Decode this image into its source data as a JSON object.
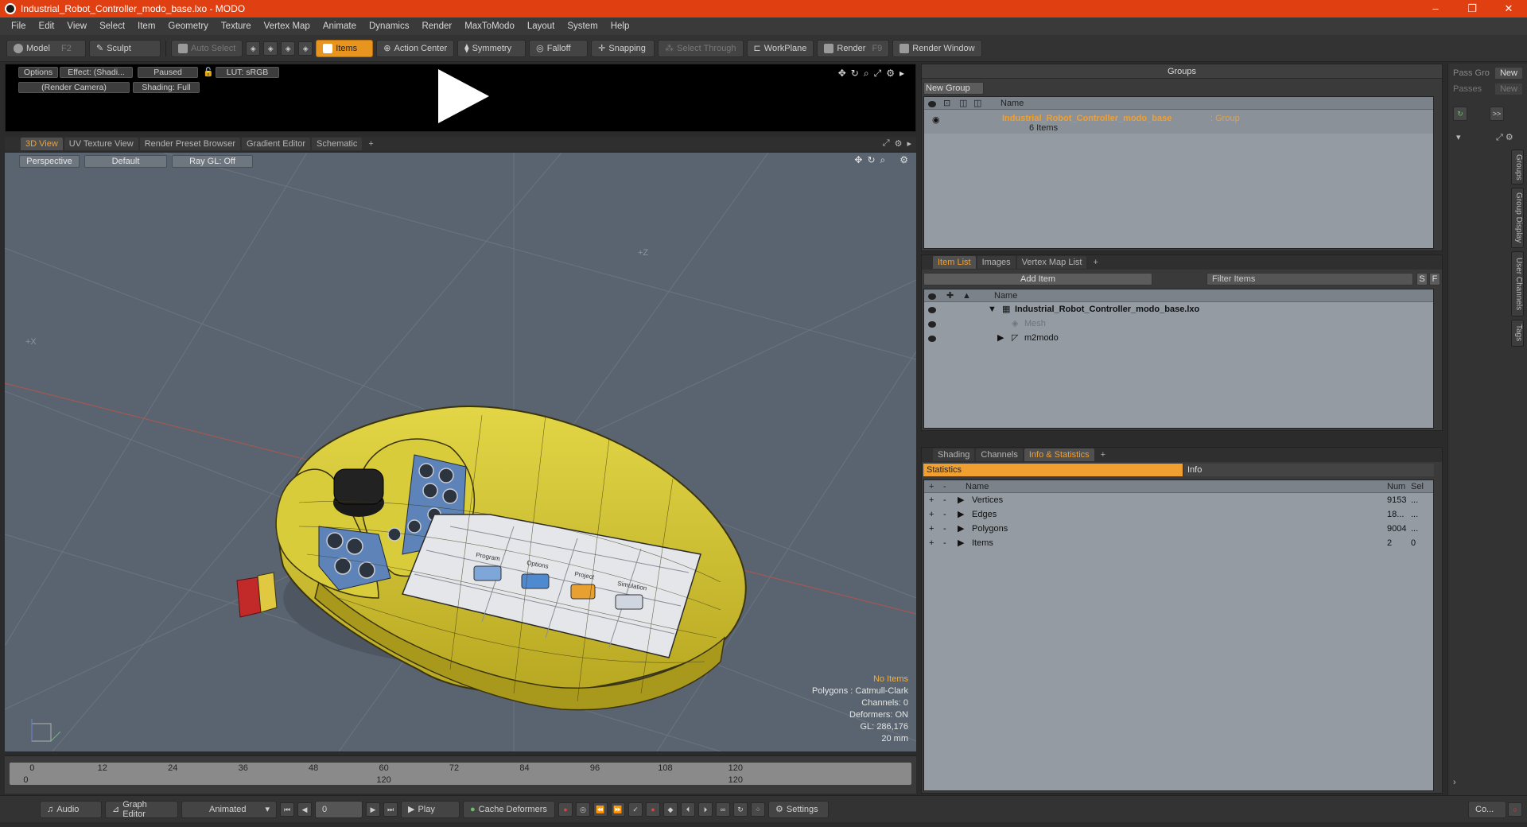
{
  "window": {
    "title": "Industrial_Robot_Controller_modo_base.lxo - MODO",
    "minimize": "–",
    "maximize": "❐",
    "close": "✕"
  },
  "menu": [
    "File",
    "Edit",
    "View",
    "Select",
    "Item",
    "Geometry",
    "Texture",
    "Vertex Map",
    "Animate",
    "Dynamics",
    "Render",
    "MaxToModo",
    "Layout",
    "System",
    "Help"
  ],
  "toolbar": {
    "model": "Model",
    "model_key": "F2",
    "sculpt": "Sculpt",
    "auto_select": "Auto Select",
    "items": "Items",
    "action_center": "Action Center",
    "symmetry": "Symmetry",
    "falloff": "Falloff",
    "snapping": "Snapping",
    "select_through": "Select Through",
    "workplane": "WorkPlane",
    "render": "Render",
    "render_key": "F9",
    "render_window": "Render Window"
  },
  "preview": {
    "options": "Options",
    "effect": "Effect: (Shadi...",
    "paused": "Paused",
    "lut": "LUT: sRGB",
    "camera": "(Render Camera)",
    "shading": "Shading: Full"
  },
  "viewport_tabs": [
    "3D View",
    "UV Texture View",
    "Render Preset Browser",
    "Gradient Editor",
    "Schematic",
    "+"
  ],
  "viewport": {
    "perspective": "Perspective",
    "default": "Default",
    "raygl": "Ray GL: Off",
    "axis_z": "+Z",
    "axis_x": "+X",
    "info": {
      "no_items": "No Items",
      "polygons": "Polygons : Catmull-Clark",
      "channels": "Channels: 0",
      "deformers": "Deformers: ON",
      "gl": "GL: 286,176",
      "scale": "20 mm"
    },
    "screen_labels": [
      "Program",
      "Options",
      "Project",
      "Simulation"
    ]
  },
  "timeline": {
    "ticks": [
      "0",
      "12",
      "24",
      "36",
      "48",
      "60",
      "72",
      "84",
      "96",
      "108",
      "120"
    ],
    "lower": [
      "0",
      "120",
      "120"
    ]
  },
  "transport": {
    "audio": "Audio",
    "graph_editor": "Graph Editor",
    "animated": "Animated",
    "frame": "0",
    "play": "Play",
    "cache_deformers": "Cache Deformers",
    "settings": "Settings"
  },
  "groups": {
    "title": "Groups",
    "new_group": "New Group",
    "col_name": "Name",
    "item_name": "Industrial_Robot_Controller_modo_base",
    "item_type": ": Group",
    "item_count": "6 Items"
  },
  "passes": {
    "pass_group": "Pass Gro",
    "passes": "Passes",
    "new1": "New",
    "new2": "New",
    "more": ">>"
  },
  "item_list": {
    "tabs": [
      "Item List",
      "Images",
      "Vertex Map List",
      "+"
    ],
    "add_item": "Add Item",
    "filter": "Filter Items",
    "s": "S",
    "f": "F",
    "col_name": "Name",
    "rows": [
      {
        "label": "Industrial_Robot_Controller_modo_base.lxo"
      },
      {
        "label": "Mesh"
      },
      {
        "label": "m2modo"
      }
    ]
  },
  "stats": {
    "tabs": [
      "Shading",
      "Channels",
      "Info & Statistics",
      "+"
    ],
    "statistics": "Statistics",
    "info": "Info",
    "col_name": "Name",
    "col_num": "Num",
    "col_sel": "Sel",
    "rows": [
      {
        "name": "Vertices",
        "num": "9153",
        "sel": "..."
      },
      {
        "name": "Edges",
        "num": "18...",
        "sel": "..."
      },
      {
        "name": "Polygons",
        "num": "9004",
        "sel": "..."
      },
      {
        "name": "Items",
        "num": "2",
        "sel": "0"
      }
    ]
  },
  "side_tabs": [
    "Groups",
    "Group Display",
    "User Channels",
    "Tags"
  ],
  "bottom_right": {
    "co": "Co..."
  }
}
